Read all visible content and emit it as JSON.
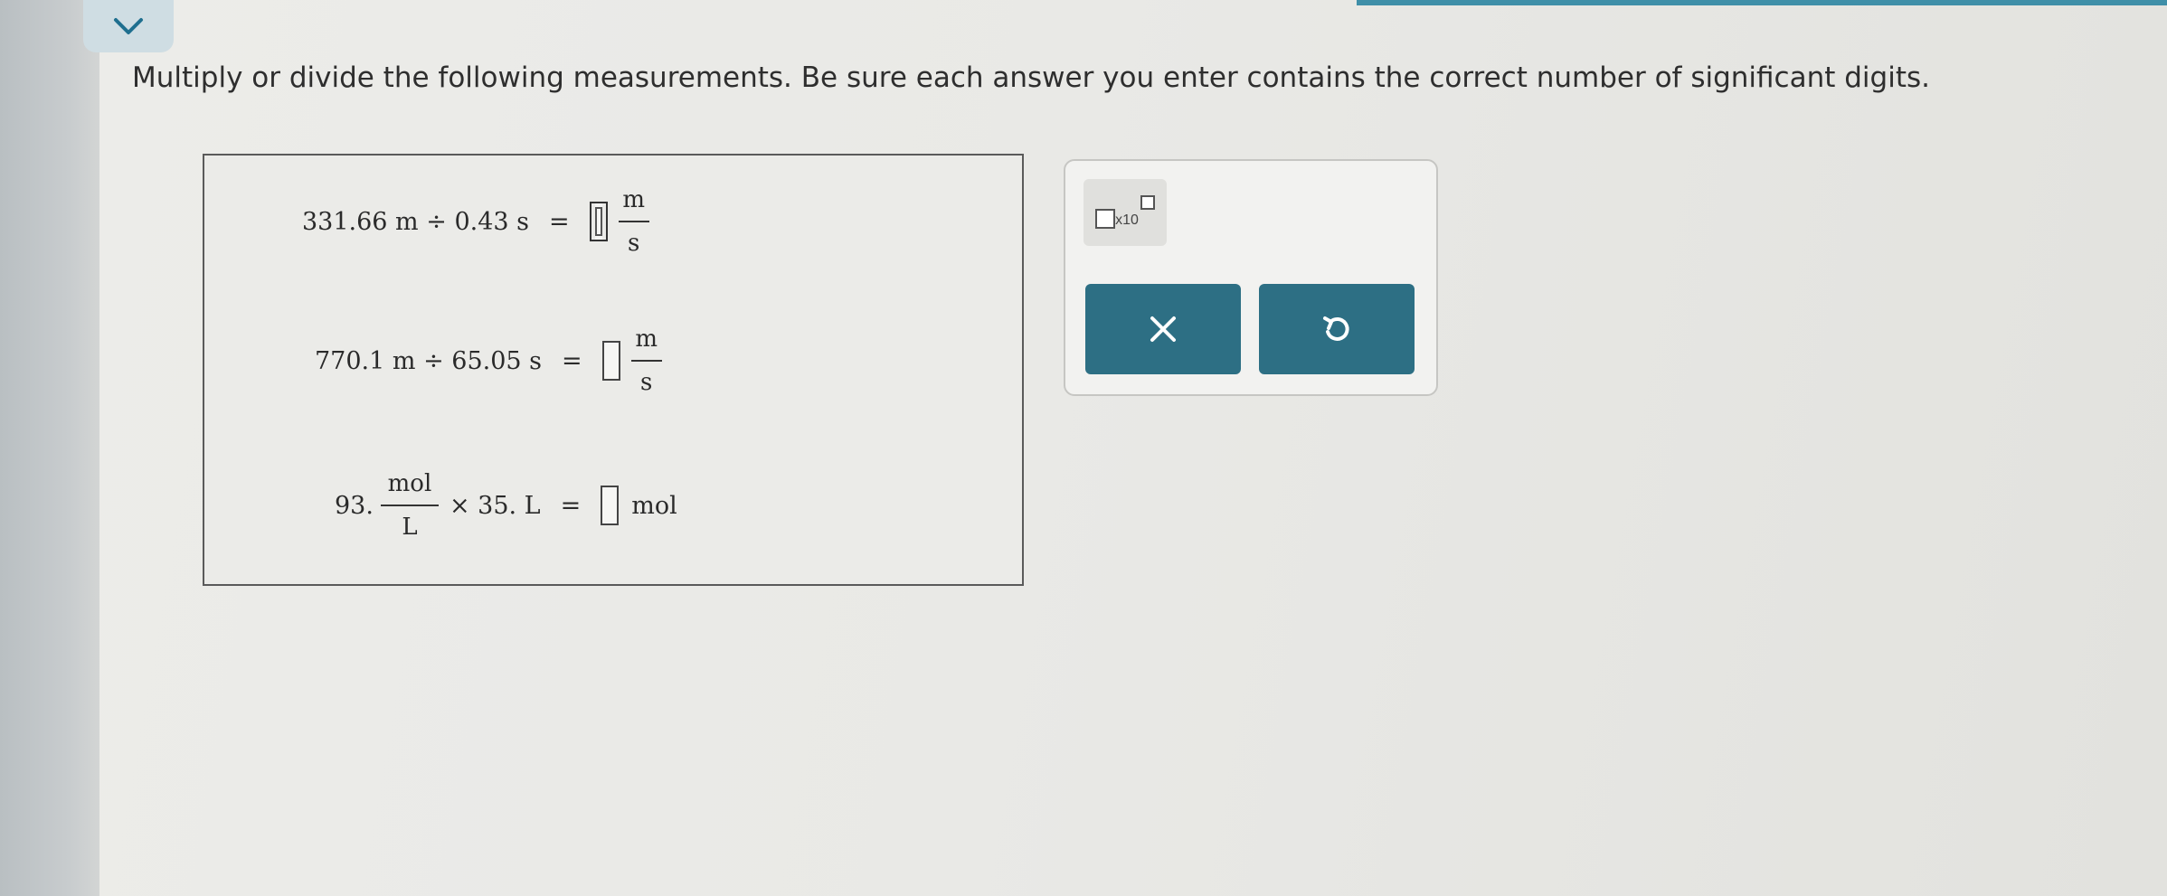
{
  "instructions": "Multiply or divide the following measurements. Be sure each answer you enter contains the correct number of significant digits.",
  "collapse_icon": "chevron-down-icon",
  "problems": [
    {
      "expression": "331.66 m ÷ 0.43 s",
      "equals": "=",
      "answer": "",
      "unit_num": "m",
      "unit_den": "s"
    },
    {
      "expression": "770.1 m ÷ 65.05 s",
      "equals": "=",
      "answer": "",
      "unit_num": "m",
      "unit_den": "s"
    },
    {
      "lead": "93.",
      "frac_num": "mol",
      "frac_den": "L",
      "times": "× 35. L",
      "equals": "=",
      "answer": "",
      "unit": "mol"
    }
  ],
  "tools": {
    "sci_label": "x10",
    "clear_icon": "close-icon",
    "undo_icon": "undo-icon"
  },
  "colors": {
    "accent": "#2d6f84",
    "top_bar": "#3f8fa8"
  }
}
